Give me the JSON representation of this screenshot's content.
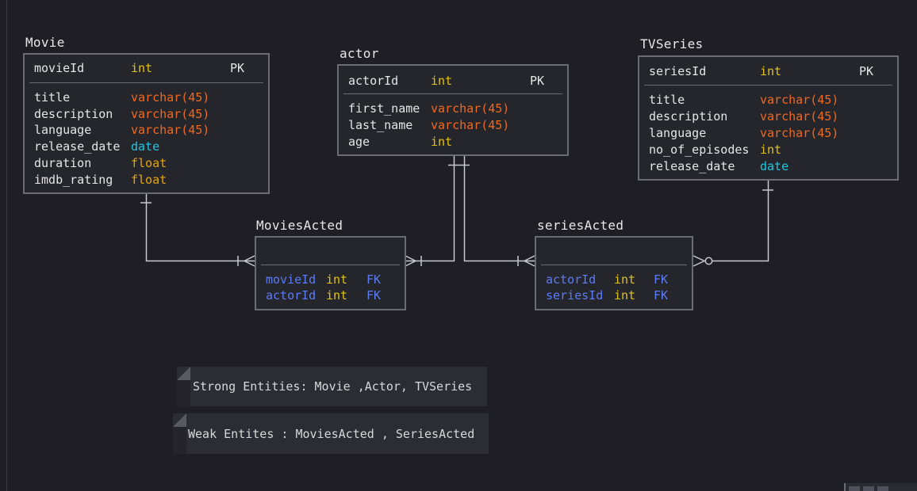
{
  "diagram": {
    "tables": [
      {
        "id": "movie",
        "name": "Movie",
        "key_rows": [
          {
            "name": "movieId",
            "type": "int",
            "type_class": "int",
            "key": "PK"
          }
        ],
        "rows": [
          {
            "name": "title",
            "type": "varchar(45)",
            "type_class": "varchar"
          },
          {
            "name": "description",
            "type": "varchar(45)",
            "type_class": "varchar"
          },
          {
            "name": "language",
            "type": "varchar(45)",
            "type_class": "varchar"
          },
          {
            "name": "release_date",
            "type": "date",
            "type_class": "date"
          },
          {
            "name": "duration",
            "type": "float",
            "type_class": "float"
          },
          {
            "name": "imdb_rating",
            "type": "float",
            "type_class": "float"
          }
        ]
      },
      {
        "id": "actor",
        "name": "actor",
        "key_rows": [
          {
            "name": "actorId",
            "type": "int",
            "type_class": "int",
            "key": "PK"
          }
        ],
        "rows": [
          {
            "name": "first_name",
            "type": "varchar(45)",
            "type_class": "varchar"
          },
          {
            "name": "last_name",
            "type": "varchar(45)",
            "type_class": "varchar"
          },
          {
            "name": "age",
            "type": "int",
            "type_class": "int"
          }
        ]
      },
      {
        "id": "tvseries",
        "name": "TVSeries",
        "key_rows": [
          {
            "name": "seriesId",
            "type": "int",
            "type_class": "int",
            "key": "PK"
          }
        ],
        "rows": [
          {
            "name": "title",
            "type": "varchar(45)",
            "type_class": "varchar"
          },
          {
            "name": "description",
            "type": "varchar(45)",
            "type_class": "varchar"
          },
          {
            "name": "language",
            "type": "varchar(45)",
            "type_class": "varchar"
          },
          {
            "name": "no_of_episodes",
            "type": "int",
            "type_class": "int"
          },
          {
            "name": "release_date",
            "type": "date",
            "type_class": "date"
          }
        ]
      },
      {
        "id": "moviesacted",
        "name": "MoviesActed",
        "key_rows": [],
        "rows": [
          {
            "name": "movieId",
            "type": "int",
            "type_class": "int",
            "key": "FK"
          },
          {
            "name": "actorId",
            "type": "int",
            "type_class": "int",
            "key": "FK"
          }
        ]
      },
      {
        "id": "seriesacted",
        "name": "seriesActed",
        "key_rows": [],
        "rows": [
          {
            "name": "actorId",
            "type": "int",
            "type_class": "int",
            "key": "FK"
          },
          {
            "name": "seriesId",
            "type": "int",
            "type_class": "int",
            "key": "FK"
          }
        ]
      }
    ],
    "notes": [
      {
        "text": "Strong Entities: Movie ,Actor, TVSeries"
      },
      {
        "text": "Weak Entites : MoviesActed , SeriesActed"
      }
    ],
    "colors": {
      "background": "#1e1e24",
      "table_fill": "#25252c",
      "border": "#6b6b74",
      "connector": "#c8c8d0",
      "fk_name": "#5b7cf7",
      "int": "#e0c21a",
      "varchar": "#f06a1e",
      "date": "#21c6df",
      "float": "#e6a50f"
    },
    "relationships": [
      {
        "from": "movie",
        "to": "moviesacted",
        "from_end": "one-mandatory",
        "to_end": "one-or-many"
      },
      {
        "from": "actor",
        "to": "moviesacted",
        "from_end": "one-mandatory",
        "to_end": "one-or-many"
      },
      {
        "from": "actor",
        "to": "seriesacted",
        "from_end": "one-mandatory",
        "to_end": "one-or-many"
      },
      {
        "from": "tvseries",
        "to": "seriesacted",
        "from_end": "one-mandatory",
        "to_end": "zero-or-many"
      }
    ]
  }
}
